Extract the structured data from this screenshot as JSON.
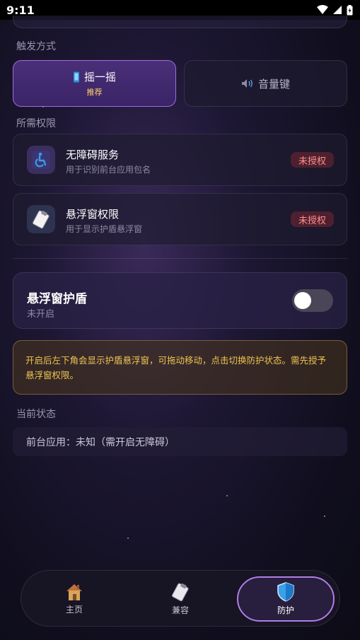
{
  "status_bar": {
    "time": "9:11"
  },
  "sections": {
    "trigger_label": "触发方式",
    "permissions_label": "所需权限",
    "current_status_label": "当前状态"
  },
  "trigger": {
    "shake": {
      "label": "摇一摇",
      "sub": "推荐",
      "icon": "phone-icon",
      "selected": true
    },
    "volume": {
      "label": "音量键",
      "icon": "speaker-icon",
      "selected": false
    }
  },
  "permissions": [
    {
      "title": "无障碍服务",
      "desc": "用于识别前台应用包名",
      "badge": "未授权",
      "icon": "accessibility-icon"
    },
    {
      "title": "悬浮窗权限",
      "desc": "用于显示护盾悬浮窗",
      "badge": "未授权",
      "icon": "clipboard-icon"
    }
  ],
  "shield": {
    "title": "悬浮窗护盾",
    "status": "未开启",
    "enabled": false
  },
  "notice": "开启后左下角会显示护盾悬浮窗，可拖动移动，点击切换防护状态。需先授予悬浮窗权限。",
  "current_status": "前台应用：未知（需开启无障碍）",
  "nav": [
    {
      "label": "主页",
      "icon": "house-icon",
      "active": false
    },
    {
      "label": "兼容",
      "icon": "clipboard-icon",
      "active": false
    },
    {
      "label": "防护",
      "icon": "shield-icon",
      "active": true
    }
  ],
  "colors": {
    "accent": "#9b6ee0",
    "warning_text": "#f0c453",
    "badge_text": "#ff8f8f",
    "recommend_text": "#ffd36a"
  }
}
